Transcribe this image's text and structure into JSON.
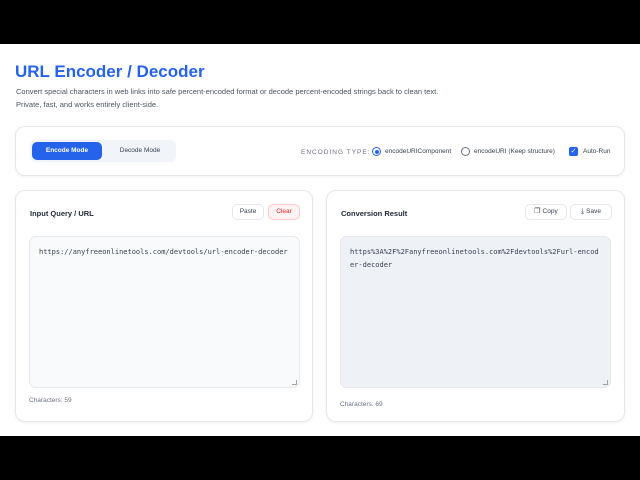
{
  "header": {
    "title": "URL Encoder / Decoder",
    "subtitle": "Convert special characters in web links into safe percent-encoded format or decode percent-encoded strings back to clean text. Private, fast, and works entirely client-side."
  },
  "toolbar": {
    "modes": [
      {
        "label": "Encode Mode",
        "active": true
      },
      {
        "label": "Decode Mode",
        "active": false
      }
    ],
    "encoding_type_label": "ENCODING TYPE:",
    "encoding_options": [
      {
        "label": "encodeURIComponent",
        "selected": true
      },
      {
        "label": "encodeURI (Keep structure)",
        "selected": false
      }
    ],
    "auto_run": {
      "label": "Auto-Run",
      "checked": true
    }
  },
  "input_panel": {
    "title": "Input Query / URL",
    "paste_label": "Paste",
    "clear_label": "Clear",
    "value": "https://anyfreeonlinetools.com/devtools/url-encoder-decoder",
    "char_count": "Characters: 59"
  },
  "output_panel": {
    "title": "Conversion Result",
    "copy_label": "Copy",
    "save_label": "Save",
    "value": "https%3A%2F%2Fanyfreeonlinetools.com%2Fdevtools%2Furl-encoder-decoder",
    "char_count": "Characters: 69"
  },
  "colors": {
    "accent": "#2563eb",
    "danger": "#dc2626"
  }
}
